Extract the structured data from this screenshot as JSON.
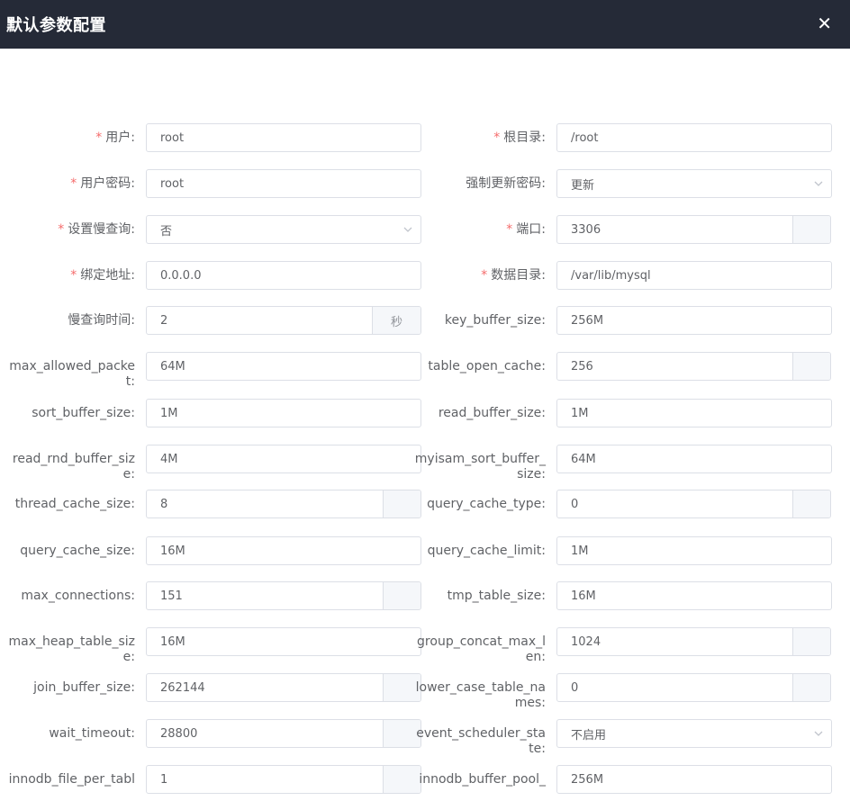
{
  "dialog": {
    "title": "默认参数配置",
    "close_symbol": "✕"
  },
  "required_mark": "*",
  "fields": [
    {
      "id": "user",
      "label": "用户:",
      "required": true,
      "value": "root",
      "kind": "text"
    },
    {
      "id": "root_dir",
      "label": "根目录:",
      "required": true,
      "value": "/root",
      "kind": "text"
    },
    {
      "id": "user_password",
      "label": "用户密码:",
      "required": true,
      "value": "root",
      "kind": "text"
    },
    {
      "id": "force_update_password",
      "label": "强制更新密码:",
      "required": false,
      "value": "更新",
      "kind": "select"
    },
    {
      "id": "slow_query",
      "label": "设置慢查询:",
      "required": true,
      "value": "否",
      "kind": "select"
    },
    {
      "id": "port",
      "label": "端口:",
      "required": true,
      "value": "3306",
      "kind": "number"
    },
    {
      "id": "bind_address",
      "label": "绑定地址:",
      "required": true,
      "value": "0.0.0.0",
      "kind": "text"
    },
    {
      "id": "data_dir",
      "label": "数据目录:",
      "required": true,
      "value": "/var/lib/mysql",
      "kind": "text"
    },
    {
      "id": "slow_query_time",
      "label": "慢查询时间:",
      "required": false,
      "value": "2",
      "kind": "append",
      "append": "秒"
    },
    {
      "id": "key_buffer_size",
      "label": "key_buffer_size:",
      "required": false,
      "value": "256M",
      "kind": "text"
    },
    {
      "id": "max_allowed_packet",
      "label": "max_allowed_packe",
      "label_wrap": "t:",
      "required": false,
      "value": "64M",
      "kind": "text"
    },
    {
      "id": "table_open_cache",
      "label": "table_open_cache:",
      "required": false,
      "value": "256",
      "kind": "number"
    },
    {
      "id": "sort_buffer_size",
      "label": "sort_buffer_size:",
      "required": false,
      "value": "1M",
      "kind": "text"
    },
    {
      "id": "read_buffer_size",
      "label": "read_buffer_size:",
      "required": false,
      "value": "1M",
      "kind": "text"
    },
    {
      "id": "read_rnd_buffer_size",
      "label": "read_rnd_buffer_siz",
      "label_wrap": "e:",
      "required": false,
      "value": "4M",
      "kind": "text"
    },
    {
      "id": "myisam_sort_buffer_size",
      "label": "myisam_sort_buffer_",
      "label_wrap": "size:",
      "required": false,
      "value": "64M",
      "kind": "text"
    },
    {
      "id": "thread_cache_size",
      "label": "thread_cache_size:",
      "required": false,
      "value": "8",
      "kind": "number"
    },
    {
      "id": "query_cache_type",
      "label": "query_cache_type:",
      "required": false,
      "value": "0",
      "kind": "number"
    },
    {
      "id": "query_cache_size",
      "label": "query_cache_size:",
      "required": false,
      "value": "16M",
      "kind": "text"
    },
    {
      "id": "query_cache_limit",
      "label": "query_cache_limit:",
      "required": false,
      "value": "1M",
      "kind": "text"
    },
    {
      "id": "max_connections",
      "label": "max_connections:",
      "required": false,
      "value": "151",
      "kind": "number"
    },
    {
      "id": "tmp_table_size",
      "label": "tmp_table_size:",
      "required": false,
      "value": "16M",
      "kind": "text"
    },
    {
      "id": "max_heap_table_size",
      "label": "max_heap_table_siz",
      "label_wrap": "e:",
      "required": false,
      "value": "16M",
      "kind": "text"
    },
    {
      "id": "group_concat_max_len",
      "label": "group_concat_max_l",
      "label_wrap": "en:",
      "required": false,
      "value": "1024",
      "kind": "number"
    },
    {
      "id": "join_buffer_size",
      "label": "join_buffer_size:",
      "required": false,
      "value": "262144",
      "kind": "number"
    },
    {
      "id": "lower_case_table_names",
      "label": "lower_case_table_na",
      "label_wrap": "mes:",
      "required": false,
      "value": "0",
      "kind": "number"
    },
    {
      "id": "wait_timeout",
      "label": "wait_timeout:",
      "required": false,
      "value": "28800",
      "kind": "number"
    },
    {
      "id": "event_scheduler_state",
      "label": "event_scheduler_sta",
      "label_wrap": "te:",
      "required": false,
      "value": "不启用",
      "kind": "select"
    },
    {
      "id": "innodb_file_per_table",
      "label": "innodb_file_per_tabl",
      "required": false,
      "value": "1",
      "kind": "number"
    },
    {
      "id": "innodb_buffer_pool_size",
      "label": "innodb_buffer_pool_",
      "required": false,
      "value": "256M",
      "kind": "text"
    }
  ]
}
